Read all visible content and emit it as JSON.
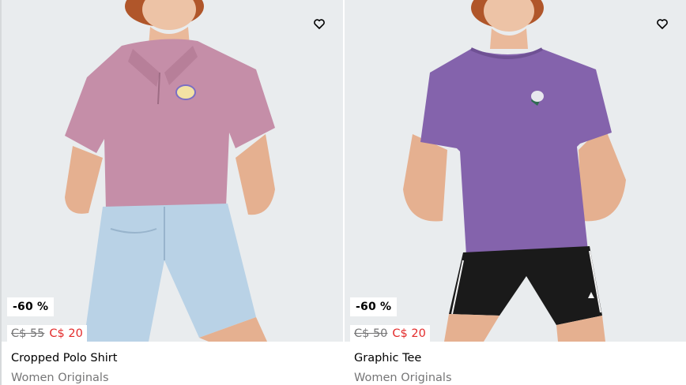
{
  "products": [
    {
      "discount": "-60 %",
      "old_price": "C$ 55",
      "new_price": "C$ 20",
      "name": "Cropped Polo Shirt",
      "category": "Women Originals",
      "shirt_color": "#c58ea8",
      "icon": "heart-outline-icon"
    },
    {
      "discount": "-60 %",
      "old_price": "C$ 50",
      "new_price": "C$ 20",
      "name": "Graphic Tee",
      "category": "Women Originals",
      "shirt_color": "#8463ac",
      "icon": "heart-outline-icon"
    }
  ],
  "colors": {
    "sale": "#e32b2b",
    "muted": "#767677",
    "background": "#e9ecee"
  }
}
